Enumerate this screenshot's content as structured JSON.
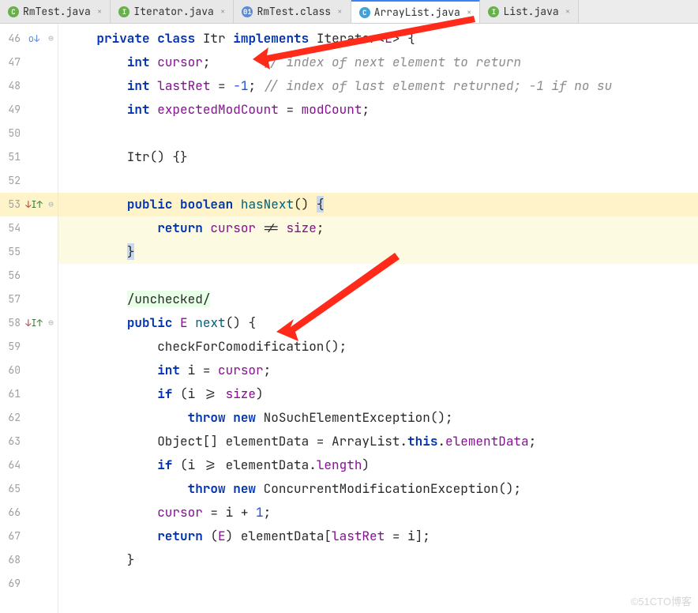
{
  "tabs": [
    {
      "icon": "C",
      "iconClass": "ic-c",
      "label": "RmTest.java"
    },
    {
      "icon": "I",
      "iconClass": "ic-i",
      "label": "Iterator.java"
    },
    {
      "icon": "01",
      "iconClass": "ic-cl",
      "label": "RmTest.class"
    },
    {
      "icon": "C",
      "iconClass": "ic-class",
      "label": "ArrayList.java",
      "active": true
    },
    {
      "icon": "I",
      "iconClass": "ic-i",
      "label": "List.java"
    }
  ],
  "lineStart": 46,
  "lines": [
    {
      "n": 46,
      "mark": "o↓",
      "fold": "⊖",
      "html": "    <span class=\"kw\">private</span> <span class=\"kw\">class</span> Itr <span class=\"kw\">implements</span> Iterator&lt;<span class=\"ident\">E</span>&gt; {"
    },
    {
      "n": 47,
      "html": "        <span class=\"kw\">int</span> <span class=\"ident\">cursor</span>;       <span class=\"cmt\">// index of next element to return</span>"
    },
    {
      "n": 48,
      "html": "        <span class=\"kw\">int</span> <span class=\"ident\">lastRet</span> = <span class=\"num\">-1</span>; <span class=\"cmt\">// index of last element returned; -1 if no su</span>"
    },
    {
      "n": 49,
      "html": "        <span class=\"kw\">int</span> <span class=\"ident\">expectedModCount</span> = <span class=\"ident\">modCount</span>;"
    },
    {
      "n": 50,
      "html": ""
    },
    {
      "n": 51,
      "html": "        Itr() {}"
    },
    {
      "n": 52,
      "html": ""
    },
    {
      "n": 53,
      "mark": "↓I↑",
      "fold": "⊖",
      "hl": true,
      "html": "        <span class=\"kw\">public</span> <span class=\"kw\">boolean</span> <span class=\"fn\">hasNext</span>() <span class=\"sel\">{</span>"
    },
    {
      "n": 54,
      "hl2": true,
      "html": "            <span class=\"kw\">return</span> <span class=\"ident\">cursor</span> != <span class=\"ident\">size</span>;"
    },
    {
      "n": 55,
      "hl2": true,
      "html": "        <span class=\"sel\">}</span>"
    },
    {
      "n": 56,
      "html": ""
    },
    {
      "n": 57,
      "html": "        <span class=\"hlbg\">/unchecked/</span>"
    },
    {
      "n": 58,
      "mark": "↓I↑",
      "fold": "⊖",
      "html": "        <span class=\"kw\">public</span> <span class=\"ident\">E</span> <span class=\"fn\">next</span>() {"
    },
    {
      "n": 59,
      "html": "            checkForComodification();"
    },
    {
      "n": 60,
      "html": "            <span class=\"kw\">int</span> i = <span class=\"ident\">cursor</span>;"
    },
    {
      "n": 61,
      "html": "            <span class=\"kw\">if</span> (i &gt;= <span class=\"ident\">size</span>)"
    },
    {
      "n": 62,
      "html": "                <span class=\"kw\">throw</span> <span class=\"kw\">new</span> NoSuchElementException();"
    },
    {
      "n": 63,
      "html": "            Object[] elementData = ArrayList.<span class=\"kw\">this</span>.<span class=\"ident\">elementData</span>;"
    },
    {
      "n": 64,
      "html": "            <span class=\"kw\">if</span> (i &gt;= elementData.<span class=\"ident\">length</span>)"
    },
    {
      "n": 65,
      "html": "                <span class=\"kw\">throw</span> <span class=\"kw\">new</span> ConcurrentModificationException();"
    },
    {
      "n": 66,
      "html": "            <span class=\"ident\">cursor</span> = i + <span class=\"num\">1</span>;"
    },
    {
      "n": 67,
      "html": "            <span class=\"kw\">return</span> (<span class=\"ident\">E</span>) elementData[<span class=\"ident\">lastRet</span> = i];"
    },
    {
      "n": 68,
      "html": "        }"
    },
    {
      "n": 69,
      "html": ""
    }
  ],
  "watermark": "©51CTO博客"
}
